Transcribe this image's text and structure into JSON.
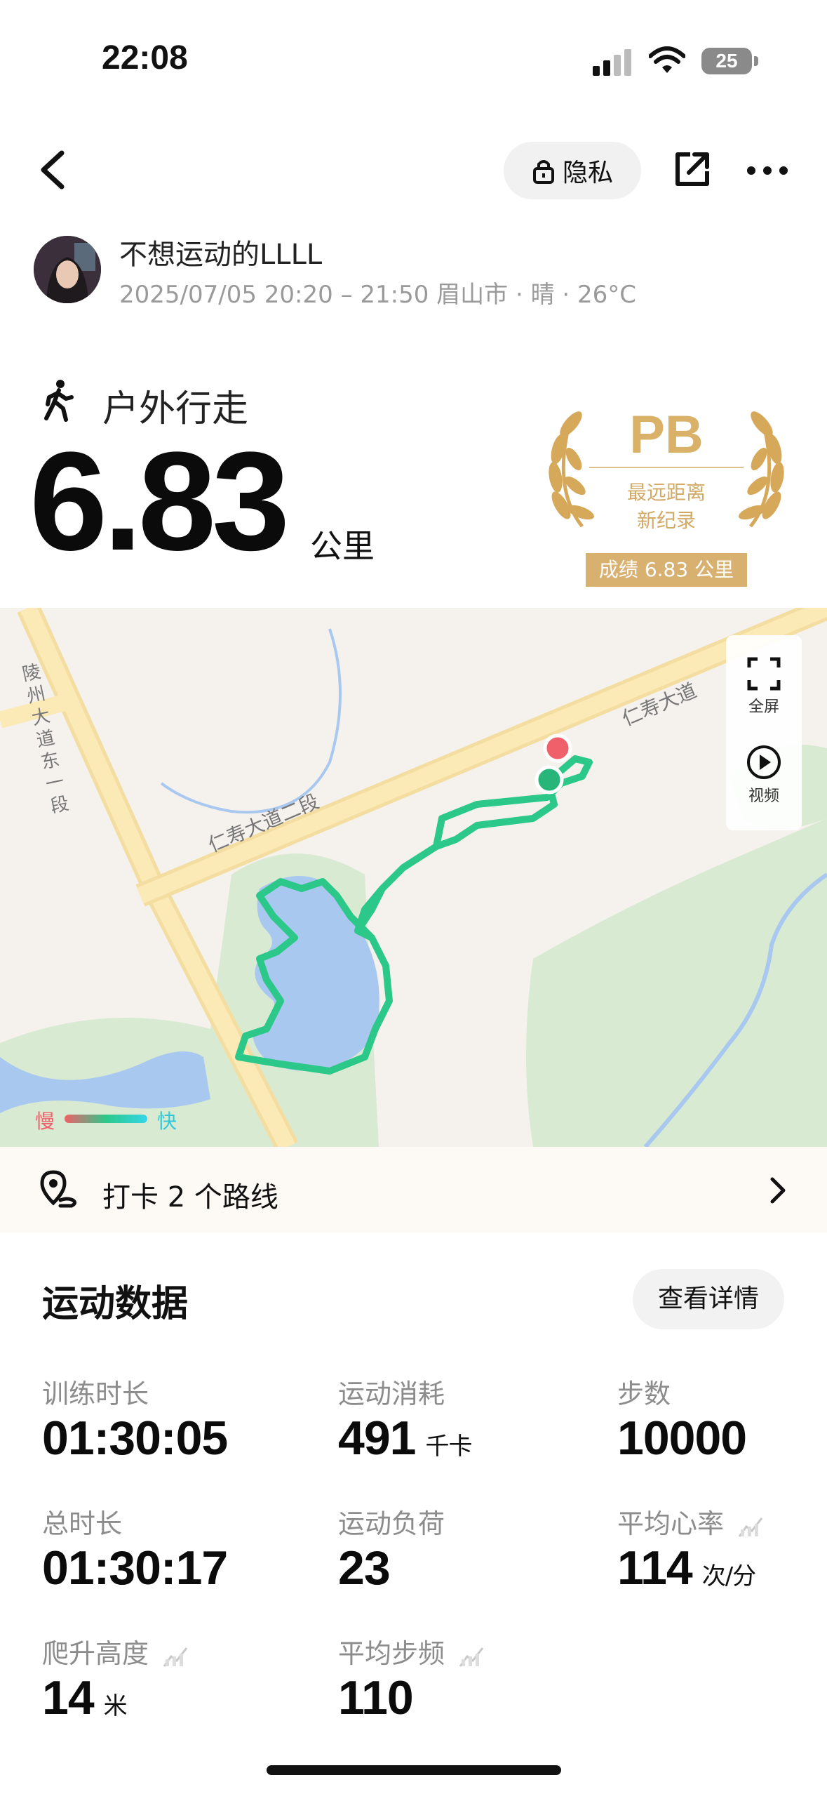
{
  "status_bar": {
    "time": "22:08",
    "battery": "25"
  },
  "header": {
    "privacy_label": "隐私"
  },
  "user": {
    "name": "不想运动的LLLL",
    "meta": "2025/07/05 20:20 – 21:50 眉山市 · 晴 · 26°C"
  },
  "activity": {
    "type": "户外行走",
    "distance": "6.83",
    "unit": "公里"
  },
  "pb_badge": {
    "title": "PB",
    "line1": "最远距离",
    "line2": "新纪录",
    "result": "成绩 6.83 公里"
  },
  "map": {
    "labels": {
      "road_vertical": "陵州大道东一段",
      "road_main": "仁寿大道二段",
      "road_main_east": "仁寿大道"
    },
    "controls": {
      "fullscreen": "全屏",
      "video": "视频"
    },
    "legend": {
      "slow": "慢",
      "fast": "快"
    },
    "colors": {
      "route": "#2cc889",
      "start": "#27b57a",
      "end": "#f0606a",
      "water": "#a9c8f0",
      "road": "#fbe3a0",
      "park": "#d9ead2"
    }
  },
  "route_row": {
    "text": "打卡 2 个路线"
  },
  "stats": {
    "title": "运动数据",
    "detail_button": "查看详情",
    "items": [
      {
        "label": "训练时长",
        "value": "01:30:05",
        "unit": ""
      },
      {
        "label": "运动消耗",
        "value": "491",
        "unit": "千卡"
      },
      {
        "label": "步数",
        "value": "10000",
        "unit": ""
      },
      {
        "label": "总时长",
        "value": "01:30:17",
        "unit": ""
      },
      {
        "label": "运动负荷",
        "value": "23",
        "unit": ""
      },
      {
        "label": "平均心率",
        "value": "114",
        "unit": "次/分"
      },
      {
        "label": "爬升高度",
        "value": "14",
        "unit": "米"
      },
      {
        "label": "平均步频",
        "value": "110",
        "unit": ""
      }
    ]
  }
}
